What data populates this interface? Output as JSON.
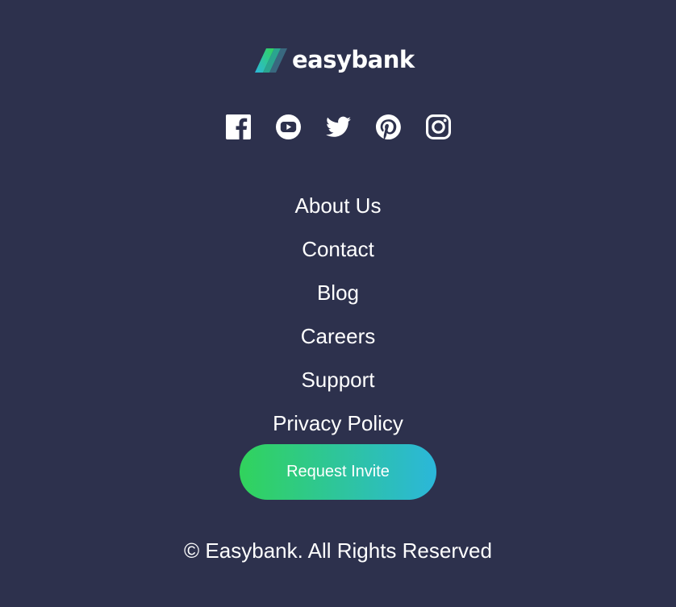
{
  "logo": {
    "text": "easybank",
    "icon": "easybank-logo-mark"
  },
  "socials": [
    {
      "name": "Facebook",
      "icon": "facebook-icon"
    },
    {
      "name": "YouTube",
      "icon": "youtube-icon"
    },
    {
      "name": "Twitter",
      "icon": "twitter-icon"
    },
    {
      "name": "Pinterest",
      "icon": "pinterest-icon"
    },
    {
      "name": "Instagram",
      "icon": "instagram-icon"
    }
  ],
  "links": [
    {
      "label": "About Us"
    },
    {
      "label": "Contact"
    },
    {
      "label": "Blog"
    },
    {
      "label": "Careers"
    },
    {
      "label": "Support"
    },
    {
      "label": "Privacy Policy"
    }
  ],
  "cta": {
    "label": "Request Invite"
  },
  "copyright": "© Easybank. All Rights Reserved",
  "colors": {
    "background": "#2d314d",
    "text": "#ffffff",
    "gradient_start": "#31d35c",
    "gradient_end": "#2bb7da"
  }
}
